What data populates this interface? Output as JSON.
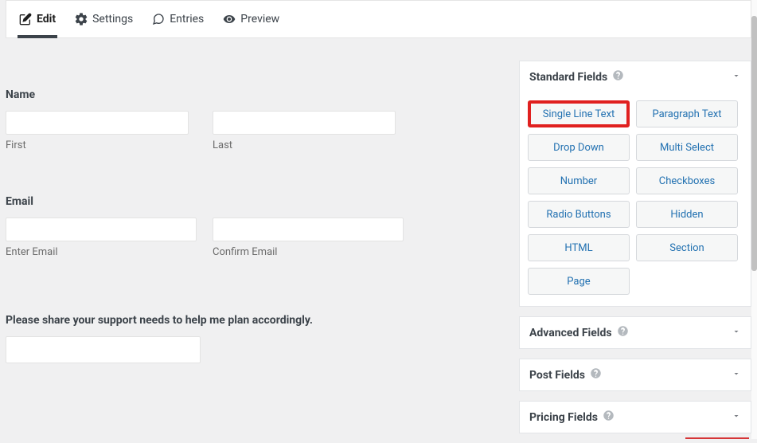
{
  "topbar": {
    "tabs": [
      {
        "label": "Edit"
      },
      {
        "label": "Settings"
      },
      {
        "label": "Entries"
      },
      {
        "label": "Preview"
      }
    ]
  },
  "form": {
    "name": {
      "label": "Name",
      "first": "First",
      "last": "Last"
    },
    "email": {
      "label": "Email",
      "enter": "Enter Email",
      "confirm": "Confirm Email"
    },
    "support": {
      "label": "Please share your support needs to help me plan accordingly."
    }
  },
  "sidebar": {
    "panels": [
      {
        "title": "Standard Fields",
        "fields": [
          "Single Line Text",
          "Paragraph Text",
          "Drop Down",
          "Multi Select",
          "Number",
          "Checkboxes",
          "Radio Buttons",
          "Hidden",
          "HTML",
          "Section",
          "Page"
        ]
      },
      {
        "title": "Advanced Fields"
      },
      {
        "title": "Post Fields"
      },
      {
        "title": "Pricing Fields"
      }
    ]
  }
}
